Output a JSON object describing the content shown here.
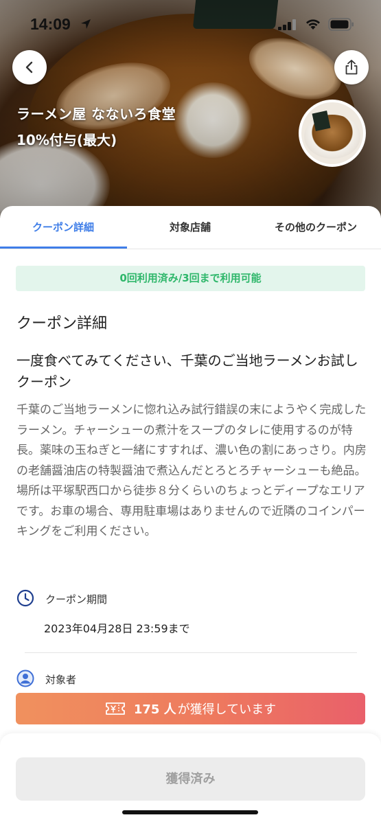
{
  "status_bar": {
    "time": "14:09"
  },
  "hero": {
    "shop_name": "ラーメン屋 なないろ食堂",
    "reward": "10%付与(最大)"
  },
  "tabs": [
    {
      "label": "クーポン詳細",
      "active": true
    },
    {
      "label": "対象店舗",
      "active": false
    },
    {
      "label": "その他のクーポン",
      "active": false
    }
  ],
  "usage_status": "0回利用済み/3回まで利用可能",
  "section_title": "クーポン詳細",
  "coupon_title": "一度食べてみてください、千葉のご当地ラーメンお試しクーポン",
  "description": "千葉のご当地ラーメンに惚れ込み試行錯誤の末にようやく完成したラーメン。チャーシューの煮汁をスープのタレに使用するのが特長。薬味の玉ねぎと一緒にすすれば、濃い色の割にあっさり。内房の老舗醤油店の特製醤油で煮込んだとろとろチャーシューも絶品。場所は平塚駅西口から徒歩８分くらいのちょっとディープなエリアです。お車の場合、専用駐車場はありませんので近隣のコインパーキングをご利用ください。",
  "period": {
    "label": "クーポン期間",
    "value": "2023年04月28日 23:59まで"
  },
  "target": {
    "label": "対象者"
  },
  "acquired_banner": {
    "count": "175 人",
    "text": "が獲得しています"
  },
  "action_button": "獲得済み",
  "colors": {
    "accent": "#3f7ee8",
    "success": "#2fb76b",
    "banner_start": "#f0915e",
    "banner_end": "#e9606a"
  }
}
